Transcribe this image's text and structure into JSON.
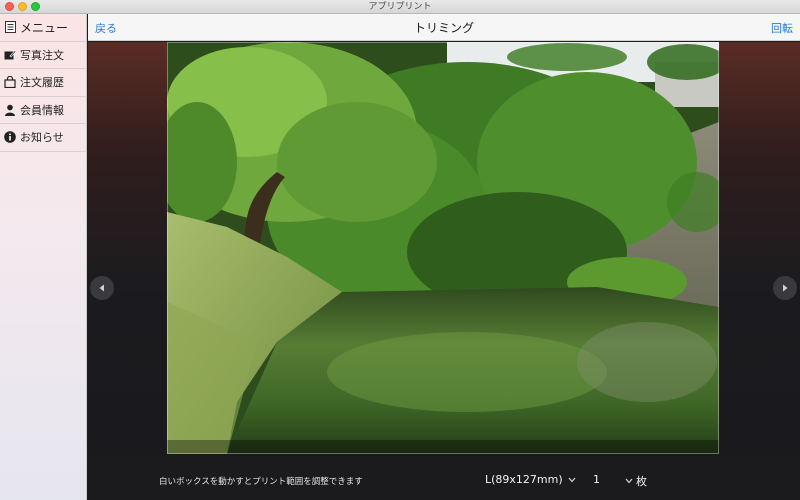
{
  "window": {
    "title": "アプリプリント"
  },
  "sidebar": {
    "items": [
      {
        "label": "メニュー",
        "icon": "list-icon"
      },
      {
        "label": "写真注文",
        "icon": "photo-edit-icon"
      },
      {
        "label": "注文履歴",
        "icon": "bag-icon"
      },
      {
        "label": "会員情報",
        "icon": "person-icon"
      },
      {
        "label": "お知らせ",
        "icon": "info-icon"
      }
    ]
  },
  "navbar": {
    "back": "戻る",
    "title": "トリミング",
    "rotate": "回転"
  },
  "photo": {
    "description": ""
  },
  "bottom": {
    "hint": "白いボックスを動かすとプリント範囲を調整できます",
    "size": "L(89x127mm)",
    "quantity": "1",
    "unit": "枚"
  },
  "colors": {
    "accent": "#2a7bd8"
  }
}
